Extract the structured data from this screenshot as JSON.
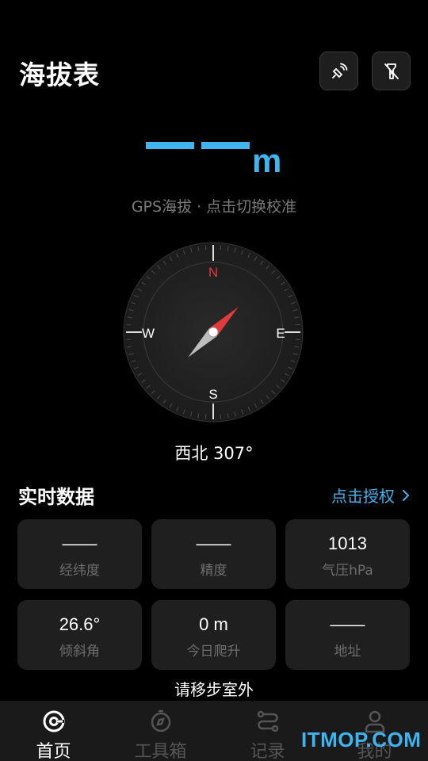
{
  "header": {
    "title": "海拔表",
    "buttons": [
      {
        "icon": "gps-signal-icon"
      },
      {
        "icon": "flashlight-off-icon"
      }
    ]
  },
  "altitude": {
    "value": "——",
    "unit": "m",
    "caption": "GPS海拔 · 点击切换校准"
  },
  "compass": {
    "north": "N",
    "east": "E",
    "south": "S",
    "west": "W",
    "heading_text": "西北 307°",
    "needle_degrees": 45
  },
  "realtime": {
    "title": "实时数据",
    "auth_label": "点击授权",
    "cards": [
      {
        "value": "——",
        "label": "经纬度"
      },
      {
        "value": "——",
        "label": "精度"
      },
      {
        "value": "1013",
        "label": "气压hPa"
      },
      {
        "value": "26.6°",
        "label": "倾斜角"
      },
      {
        "value": "0 m",
        "label": "今日爬升"
      },
      {
        "value": "——",
        "label": "地址"
      }
    ]
  },
  "hint": "请移步室外",
  "tabs": [
    {
      "label": "首页",
      "icon": "home-icon",
      "active": true
    },
    {
      "label": "工具箱",
      "icon": "compass-tool-icon",
      "active": false
    },
    {
      "label": "记录",
      "icon": "route-icon",
      "active": false
    },
    {
      "label": "我的",
      "icon": "profile-icon",
      "active": false
    }
  ],
  "watermark": "ITMOP.COM",
  "colors": {
    "accent": "#3fb4ef",
    "north_needle": "#e23b3b",
    "background": "#000000",
    "card": "#1f1f1f"
  }
}
